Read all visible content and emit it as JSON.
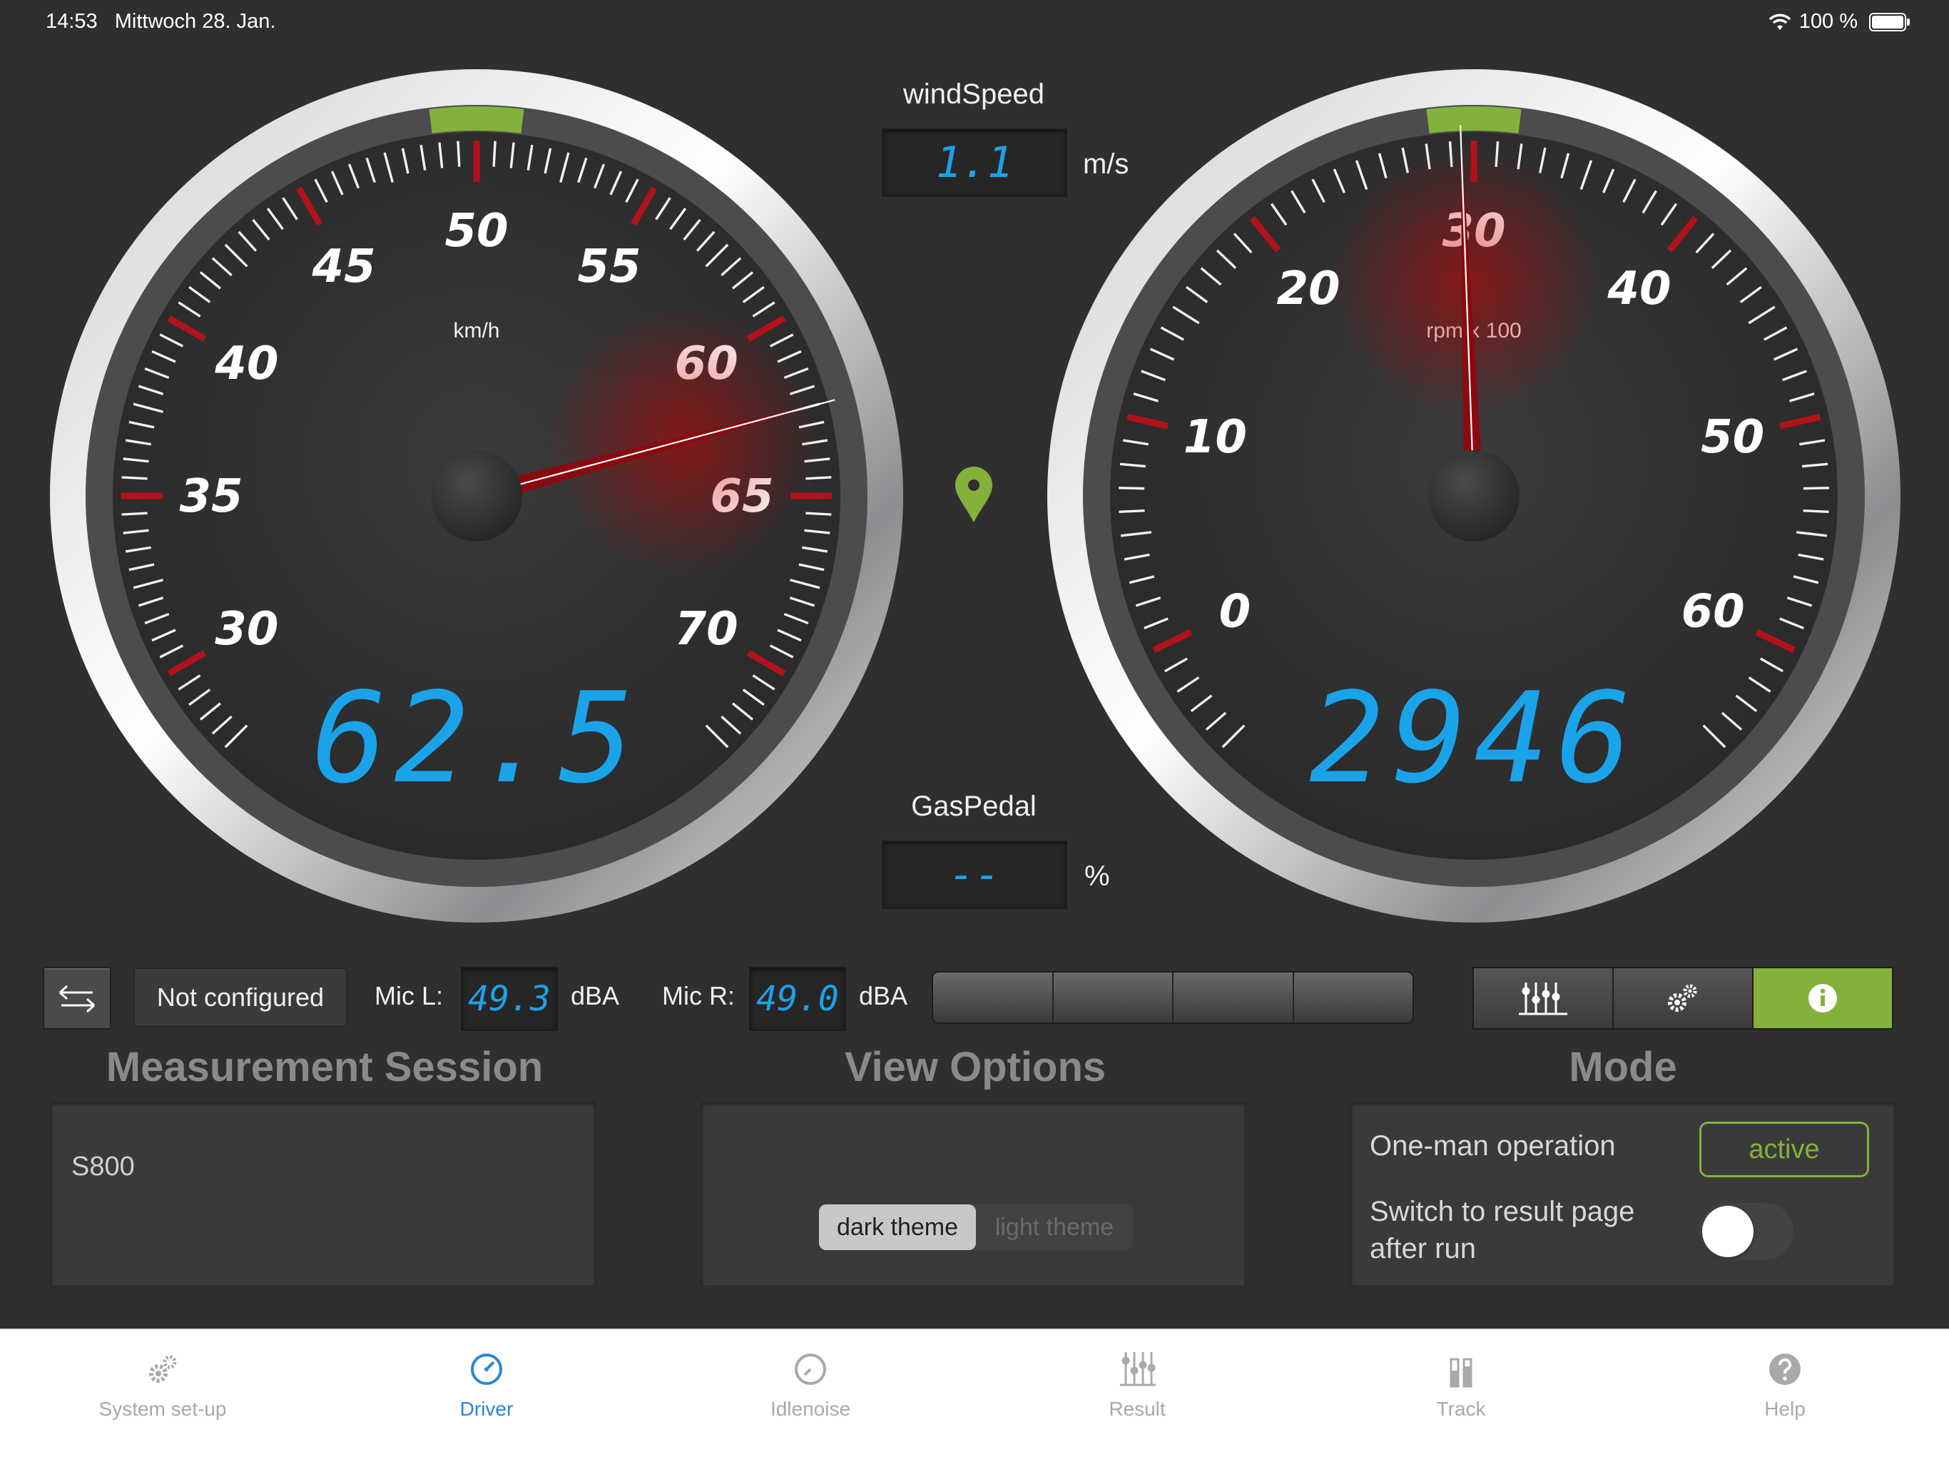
{
  "status_bar": {
    "time": "14:53",
    "date": "Mittwoch 28. Jan.",
    "battery": "100 %"
  },
  "speed_gauge": {
    "unit": "km/h",
    "ticks": [
      "30",
      "35",
      "40",
      "45",
      "50",
      "55",
      "60",
      "65",
      "70"
    ],
    "min": 27.5,
    "max": 72.5,
    "value": 62.5,
    "display": "62.5"
  },
  "rpm_gauge": {
    "unit": "rpm x 100",
    "ticks": [
      "0",
      "10",
      "20",
      "30",
      "40",
      "50",
      "60"
    ],
    "min": -5,
    "max": 65,
    "value": 29.46,
    "display": "2946"
  },
  "wind": {
    "label": "windSpeed",
    "value": "1.1",
    "unit": "m/s"
  },
  "gas": {
    "label": "GasPedal",
    "value": "--",
    "unit": "%"
  },
  "controls": {
    "not_configured": "Not configured",
    "mic_l_label": "Mic L:",
    "mic_l_value": "49.3",
    "mic_l_unit": "dBA",
    "mic_r_label": "Mic R:",
    "mic_r_value": "49.0",
    "mic_r_unit": "dBA"
  },
  "session": {
    "title": "Measurement Session",
    "name": "S800"
  },
  "view": {
    "title": "View Options",
    "dark": "dark theme",
    "light": "light theme"
  },
  "mode": {
    "title": "Mode",
    "one_man": "One-man operation",
    "one_man_state": "active",
    "switch_label_1": "Switch to result page",
    "switch_label_2": "after run"
  },
  "tabs": [
    {
      "label": "System set-up"
    },
    {
      "label": "Driver"
    },
    {
      "label": "Idlenoise"
    },
    {
      "label": "Result"
    },
    {
      "label": "Track"
    },
    {
      "label": "Help"
    }
  ],
  "colors": {
    "accent_green": "#84b13a",
    "lcd_blue": "#1ba3ea",
    "tab_active": "#2a86d8"
  }
}
